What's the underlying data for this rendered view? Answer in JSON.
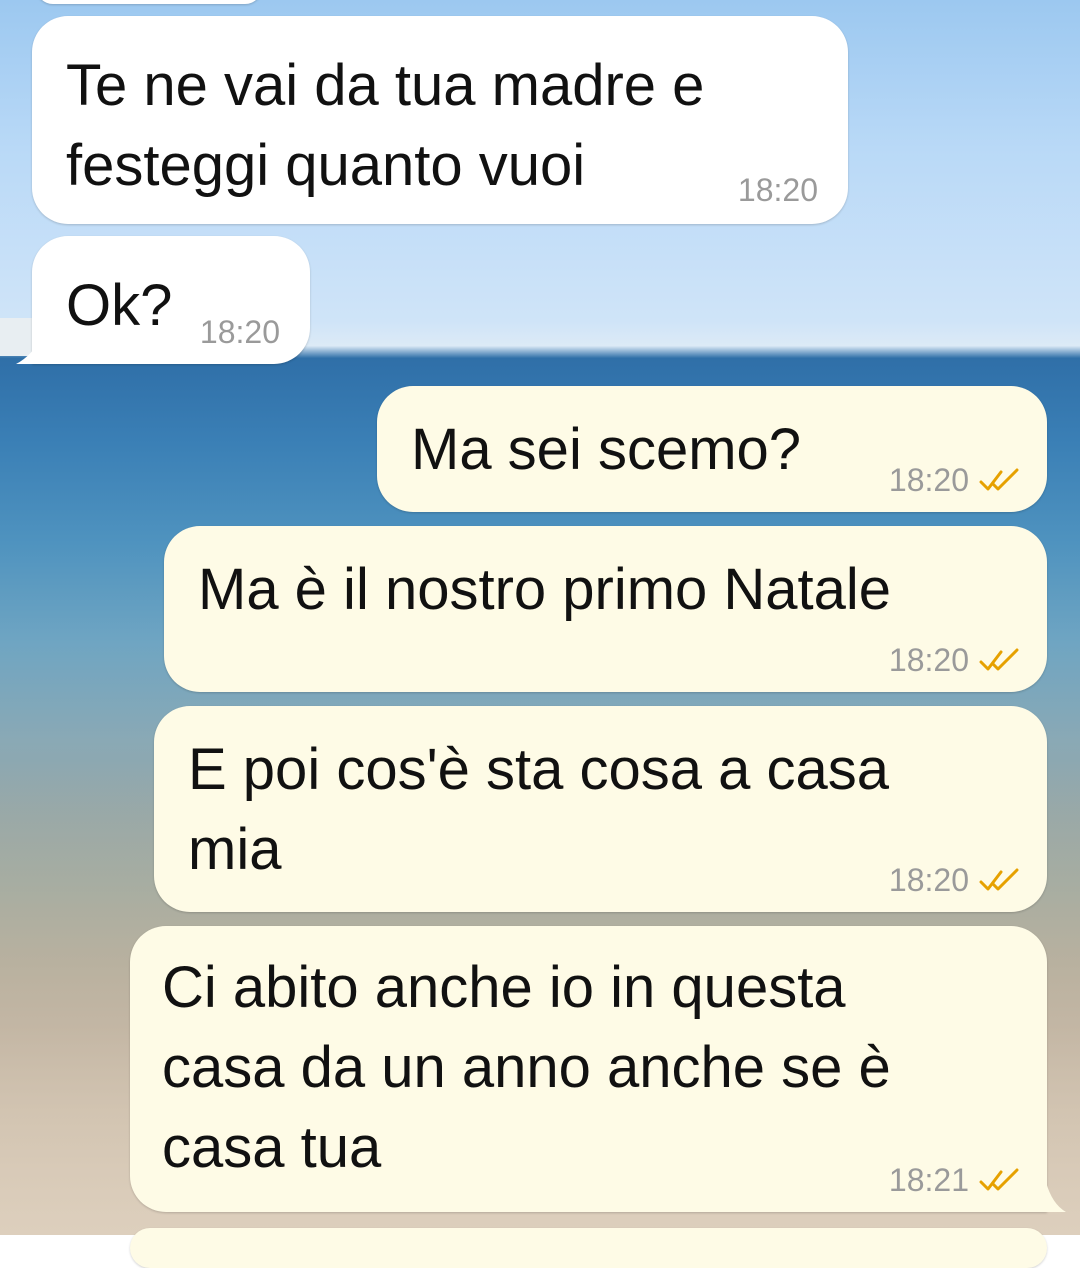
{
  "chat": {
    "messages": [
      {
        "direction": "incoming",
        "text": "Te ne vai da tua madre e\nfesteggi quanto vuoi",
        "time": "18:20"
      },
      {
        "direction": "incoming",
        "text": "Ok?",
        "time": "18:20"
      },
      {
        "direction": "outgoing",
        "text": "Ma sei scemo?",
        "time": "18:20",
        "status": "read-ticks-icon"
      },
      {
        "direction": "outgoing",
        "text": "Ma è il nostro primo Natale",
        "time": "18:20",
        "status": "read-ticks-icon"
      },
      {
        "direction": "outgoing",
        "text": "E poi cos'è sta cosa a casa\nmia",
        "time": "18:20",
        "status": "read-ticks-icon"
      },
      {
        "direction": "outgoing",
        "text": "Ci abito anche io in questa\ncasa da un anno anche se è\ncasa tua",
        "time": "18:21",
        "status": "read-ticks-icon"
      }
    ]
  },
  "colors": {
    "incoming_bubble": "#ffffff",
    "outgoing_bubble": "#fefbe6",
    "ticks": "#e6a100",
    "timestamp": "#9a9a9a"
  }
}
